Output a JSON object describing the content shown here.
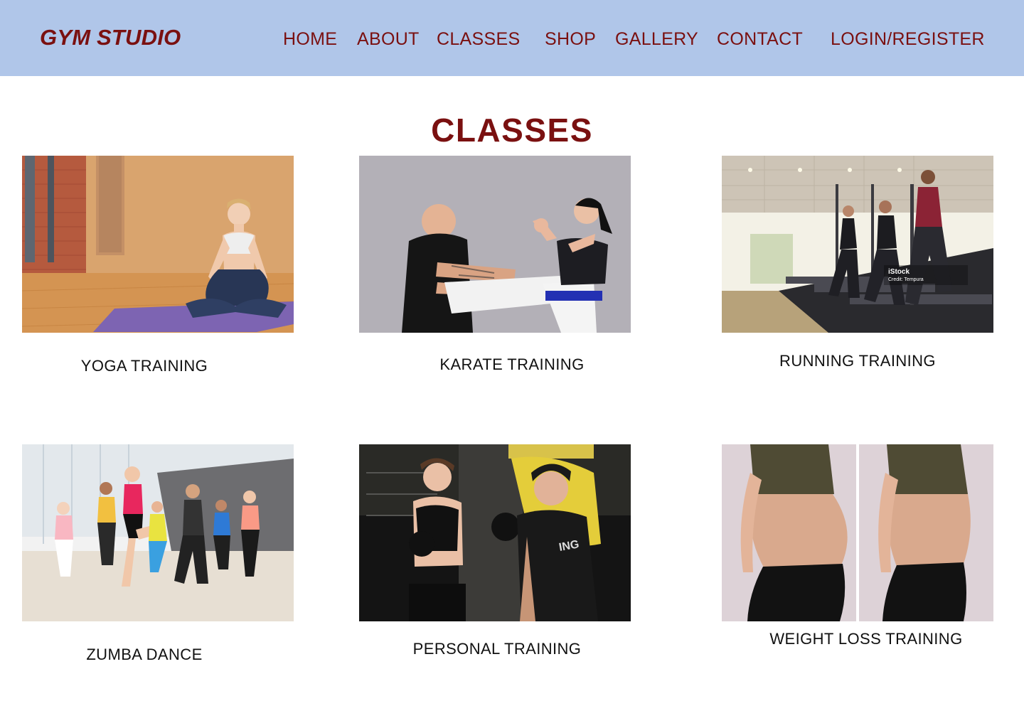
{
  "header": {
    "logo": "GYM STUDIO",
    "nav": {
      "home": "HOME",
      "about": "ABOUT",
      "classes": "CLASSES",
      "shop": "SHOP",
      "gallery": "GALLERY",
      "contact": "CONTACT",
      "login": "LOGIN/REGISTER"
    }
  },
  "page": {
    "title": "CLASSES"
  },
  "classes": [
    {
      "label": "YOGA TRAINING"
    },
    {
      "label": "KARATE TRAINING"
    },
    {
      "label": "RUNNING TRAINING",
      "watermark": "iStock",
      "credit": "Credit: Tempura"
    },
    {
      "label": "ZUMBA DANCE"
    },
    {
      "label": "PERSONAL TRAINING"
    },
    {
      "label": "WEIGHT LOSS TRAINING"
    }
  ],
  "colors": {
    "header_bg": "#b0c6e9",
    "accent": "#7a1010",
    "text": "#111111"
  }
}
